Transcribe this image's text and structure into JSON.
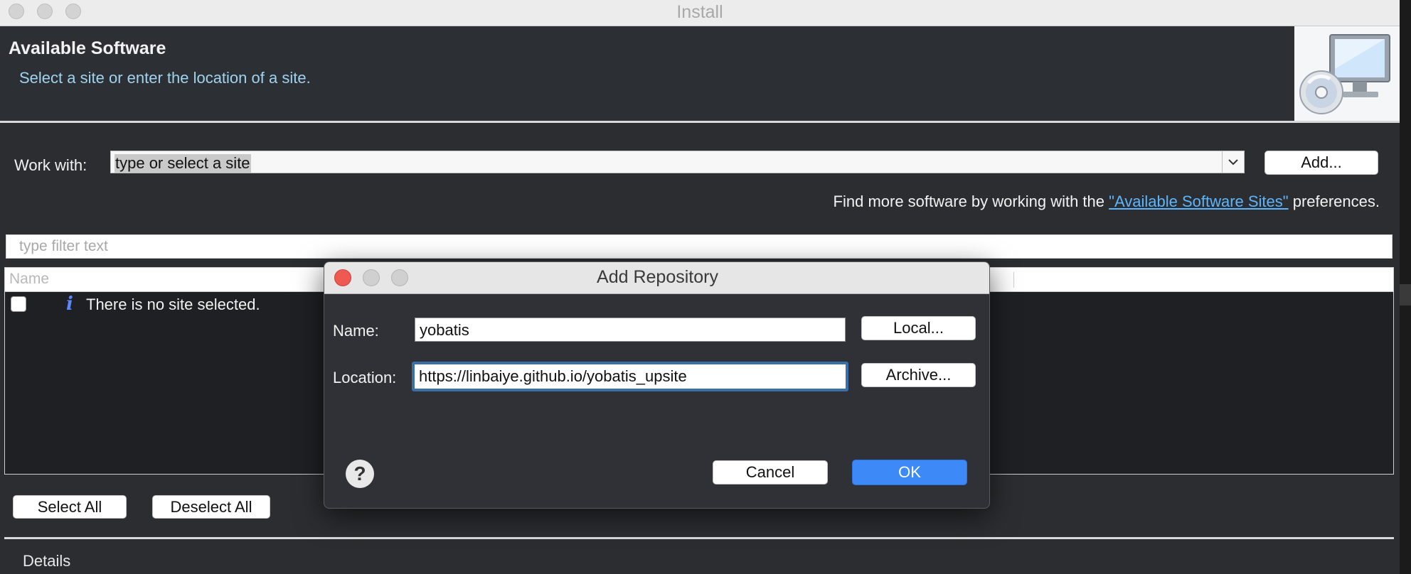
{
  "window": {
    "title": "Install"
  },
  "header": {
    "title": "Available Software",
    "subtitle": "Select a site or enter the location of a site."
  },
  "work_with": {
    "label": "Work with:",
    "value": "type or select a site",
    "add_button": "Add..."
  },
  "find_more": {
    "prefix": "Find more software by working with the ",
    "link": "\"Available Software Sites\"",
    "suffix": " preferences."
  },
  "filter": {
    "placeholder": "type filter text"
  },
  "tree": {
    "column_name": "Name",
    "row_text": "There is no site selected."
  },
  "buttons": {
    "select_all": "Select All",
    "deselect_all": "Deselect All"
  },
  "details": {
    "label": "Details"
  },
  "dialog": {
    "title": "Add Repository",
    "name_label": "Name:",
    "name_value": "yobatis",
    "location_label": "Location:",
    "location_value": "https://linbaiye.github.io/yobatis_upsite",
    "local_button": "Local...",
    "archive_button": "Archive...",
    "cancel_button": "Cancel",
    "ok_button": "OK",
    "help_icon": "?"
  },
  "colors": {
    "ok_button": "#3d89f7",
    "close_button": "#ee5a52",
    "link": "#5cb6ff",
    "subtitle": "#9fd3ef"
  }
}
